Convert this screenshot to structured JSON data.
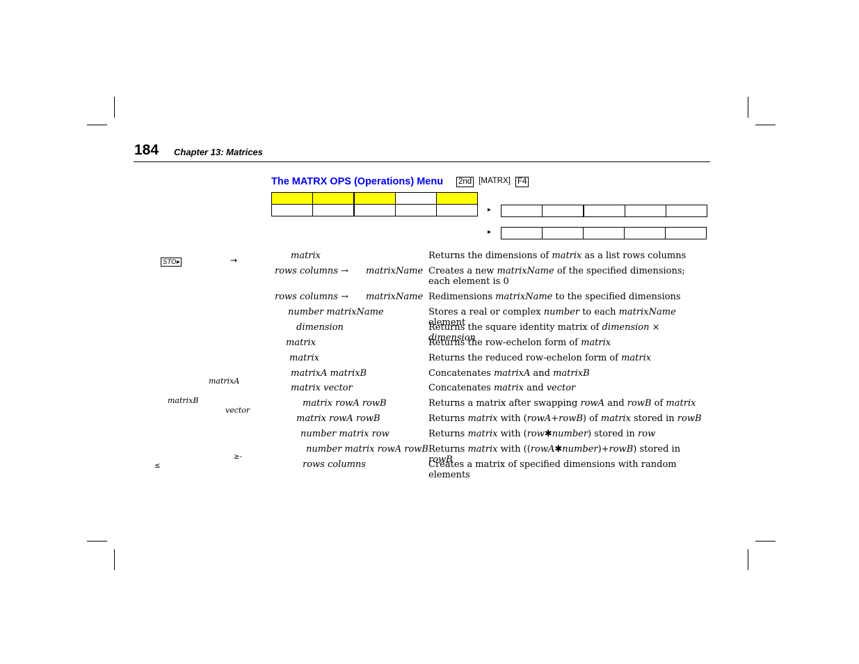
{
  "page": {
    "number": "184",
    "chapter": "Chapter 13: Matrices"
  },
  "section": {
    "title": "The MATRX OPS (Operations) Menu",
    "keys": [
      "2nd",
      "MATRX",
      "F4"
    ]
  },
  "menu_bar": {
    "row1_highlighted": [
      true,
      true,
      true,
      false,
      true
    ],
    "more_arrow": "▸"
  },
  "margin": {
    "sto_key": "STO▸",
    "arrow": "→",
    "matrixA": "matrixA",
    "matrixB": "matrixB",
    "vector": "vector",
    "ge_symbol": "≥‑",
    "le_symbol": "≤"
  },
  "functions": [
    {
      "syntax": "matrix",
      "description": [
        "Returns the dimensions of ",
        {
          "i": "matrix"
        },
        " as a list   rows columns"
      ]
    },
    {
      "syntax": "rows columns →",
      "syntax2": "matrixName",
      "description": [
        "Creates a new ",
        {
          "i": "matrixName"
        },
        " of the specified dimensions; each element is 0"
      ]
    },
    {
      "syntax": "rows columns →",
      "syntax2": "matrixName",
      "description": [
        "Redimensions ",
        {
          "i": "matrixName"
        },
        " to the specified dimensions"
      ]
    },
    {
      "syntax": "number matrixName",
      "description": [
        "Stores a real or complex ",
        {
          "i": "number"
        },
        " to each ",
        {
          "i": "matrixName"
        },
        " element"
      ]
    },
    {
      "syntax": "dimension",
      "description": [
        "Returns the square identity matrix of ",
        {
          "i": "dimension"
        },
        " × ",
        {
          "i": "dimension"
        }
      ]
    },
    {
      "syntax": "matrix",
      "description": [
        "Returns the row-echelon form of ",
        {
          "i": "matrix"
        }
      ]
    },
    {
      "syntax": "matrix",
      "description": [
        "Returns the reduced row-echelon form of ",
        {
          "i": "matrix"
        }
      ]
    },
    {
      "syntax": "matrixA matrixB",
      "description": [
        "Concatenates ",
        {
          "i": "matrixA"
        },
        " and ",
        {
          "i": "matrixB"
        }
      ]
    },
    {
      "syntax": "matrix vector",
      "description": [
        "Concatenates ",
        {
          "i": "matrix"
        },
        " and ",
        {
          "i": "vector"
        }
      ]
    },
    {
      "syntax": "matrix rowA rowB",
      "description": [
        "Returns a matrix after swapping ",
        {
          "i": "rowA"
        },
        " and ",
        {
          "i": "rowB"
        },
        " of ",
        {
          "i": "matrix"
        }
      ]
    },
    {
      "syntax": "matrix rowA rowB",
      "description": [
        "Returns ",
        {
          "i": "matrix"
        },
        " with (",
        {
          "i": "rowA"
        },
        "+",
        {
          "i": "rowB"
        },
        ") of ",
        {
          "i": "matrix"
        },
        " stored in ",
        {
          "i": "rowB"
        }
      ]
    },
    {
      "syntax": "number matrix row",
      "description": [
        "Returns ",
        {
          "i": "matrix"
        },
        " with (",
        {
          "i": "row"
        },
        "✱",
        {
          "i": "number"
        },
        ") stored in ",
        {
          "i": "row"
        }
      ]
    },
    {
      "syntax": "number matrix rowA rowB",
      "description": [
        "Returns ",
        {
          "i": "matrix"
        },
        " with ((",
        {
          "i": "rowA"
        },
        "✱",
        {
          "i": "number"
        },
        ")+",
        {
          "i": "rowB"
        },
        ") stored in ",
        {
          "i": "rowB"
        }
      ]
    },
    {
      "syntax": "rows columns",
      "description": [
        "Creates a matrix of specified dimensions with random elements"
      ]
    }
  ]
}
